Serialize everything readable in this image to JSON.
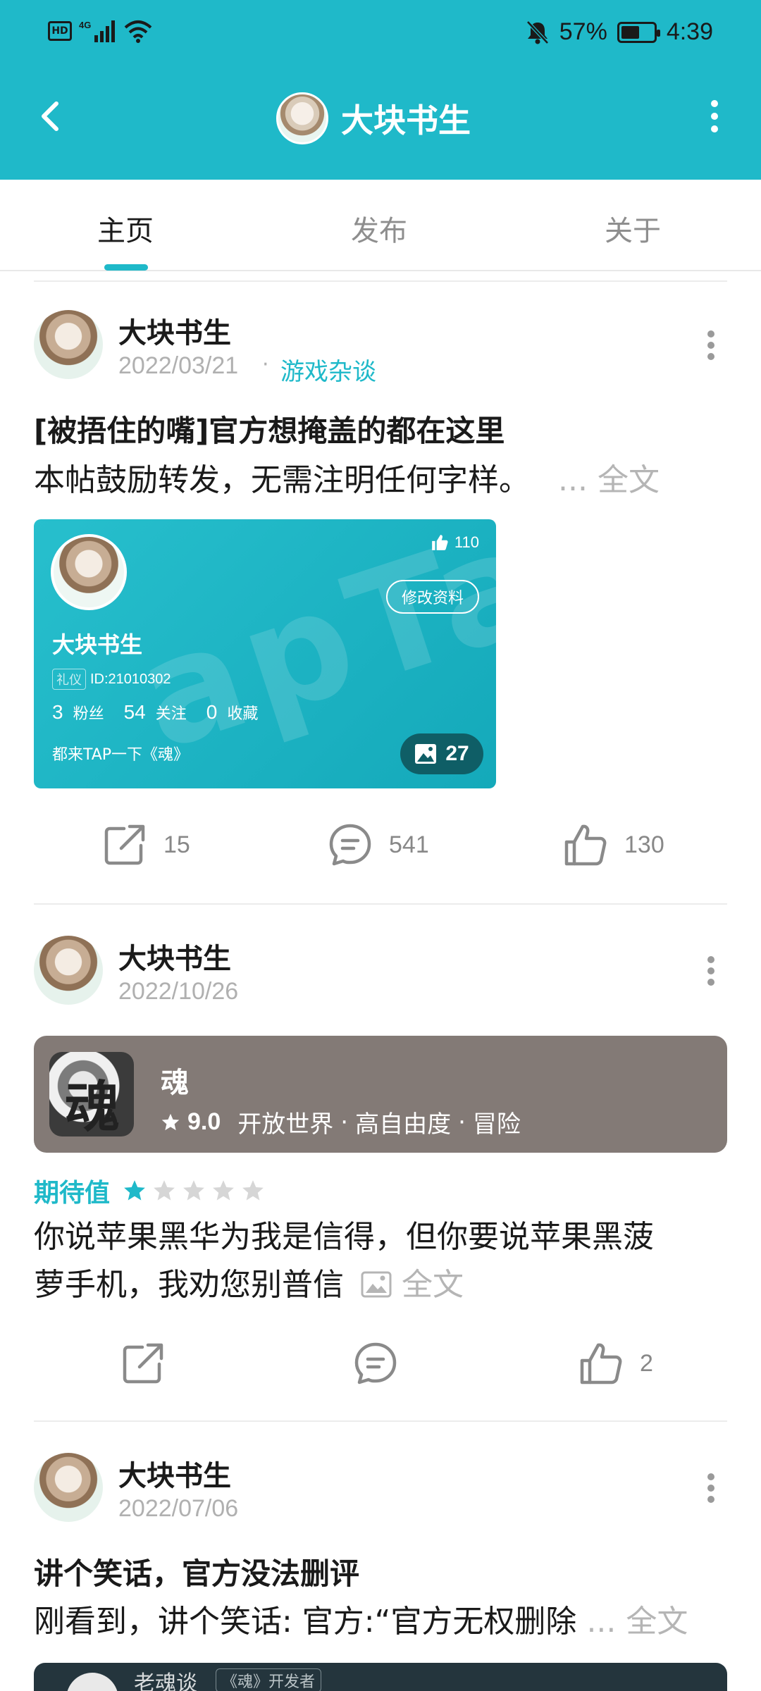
{
  "status_bar": {
    "left_icons": [
      "hd-icon",
      "signal-4g-icon",
      "wifi-icon"
    ],
    "hd_text": "HD",
    "battery_percent_text": "57%",
    "battery_level": 0.57,
    "time": "4:39"
  },
  "header": {
    "title": "大块书生",
    "accent_color": "#1fb9c9"
  },
  "tabs": [
    {
      "label": "主页",
      "active": true
    },
    {
      "label": "发布",
      "active": false
    },
    {
      "label": "关于",
      "active": false
    }
  ],
  "posts": [
    {
      "author": "大块书生",
      "date": "2022/03/21",
      "topic": "游戏杂谈",
      "title": "[被捂住的嘴]官方想掩盖的都在这里",
      "body": "本帖鼓励转发，无需注明任何字样。",
      "more": "... 全文",
      "card": {
        "likes": "110",
        "edit_label": "修改资料",
        "name": "大块书生",
        "badge": "礼仪",
        "id_text": "ID:21010302",
        "fans_num": "3",
        "fans_label": "粉丝",
        "follow_num": "54",
        "follow_label": "关注",
        "fav_num": "0",
        "fav_label": "收藏",
        "signature": "都来TAP一下《魂》",
        "gallery_count": "27"
      },
      "actions": {
        "share": "15",
        "comment": "541",
        "like": "130"
      }
    },
    {
      "author": "大块书生",
      "date": "2022/10/26",
      "game": {
        "name": "魂",
        "score": "9.0",
        "tags": [
          "开放世界",
          "高自由度",
          "冒险"
        ]
      },
      "expect_label": "期待值",
      "expect_rating": 1,
      "expect_max": 5,
      "body_line1": "你说苹果黑华为我是信得，但你要说苹果黑菠",
      "body_line2": "萝手机，我劝您别普信",
      "more": "全文",
      "actions": {
        "share": "",
        "comment": "",
        "like": "2"
      }
    },
    {
      "author": "大块书生",
      "date": "2022/07/06",
      "title": "讲个笑话，官方没法删评",
      "body": "刚看到，讲个笑话: 官方:“官方无权删除",
      "more": "... 全文",
      "quoted": {
        "name": "老魂谈",
        "tag": "《魂》开发者"
      }
    }
  ]
}
